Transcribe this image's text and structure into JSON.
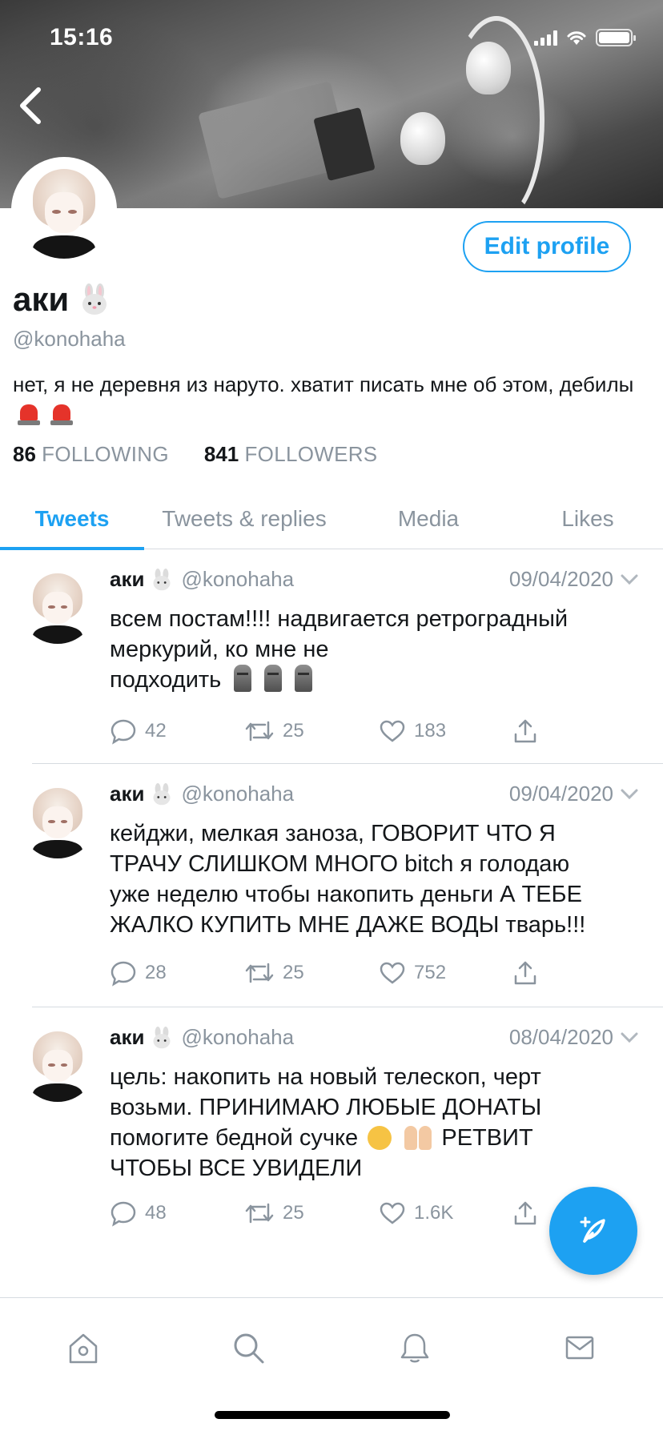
{
  "status_bar": {
    "time": "15:16"
  },
  "profile": {
    "name": "аки",
    "handle": "@konohaha",
    "bio": "нет, я не деревня из наруто. хватит писать мне об этом, дебилы",
    "following_count": "86",
    "following_label": "FOLLOWING",
    "followers_count": "841",
    "followers_label": "FOLLOWERS",
    "edit_label": "Edit profile"
  },
  "tabs": [
    {
      "label": "Tweets",
      "active": true
    },
    {
      "label": "Tweets & replies",
      "active": false
    },
    {
      "label": "Media",
      "active": false
    },
    {
      "label": "Likes",
      "active": false
    }
  ],
  "tweets": [
    {
      "name": "аки",
      "handle": "@konohaha",
      "date": "09/04/2020",
      "text_lines": [
        "всем постам!!!! надвигается ретроградный",
        "меркурий, ко мне не",
        "подходить"
      ],
      "replies": "42",
      "retweets": "25",
      "likes": "183"
    },
    {
      "name": "аки",
      "handle": "@konohaha",
      "date": "09/04/2020",
      "text_lines": [
        "кейджи, мелкая заноза, ГОВОРИТ ЧТО Я",
        "ТРАЧУ СЛИШКОМ МНОГО bitch я голодаю",
        "уже неделю чтобы накопить деньги А ТЕБЕ",
        "ЖАЛКО КУПИТЬ МНЕ ДАЖЕ ВОДЫ тварь!!!"
      ],
      "replies": "28",
      "retweets": "25",
      "likes": "752"
    },
    {
      "name": "аки",
      "handle": "@konohaha",
      "date": "08/04/2020",
      "text_lines": [
        "цель: накопить на новый телескоп, черт",
        "возьми. ПРИНИМАЮ ЛЮБЫЕ ДОНАТЫ",
        "помогите бедной сучке",
        "ЧТОБЫ ВСЕ УВИДЕЛИ"
      ],
      "text_suffix": "РЕТВИТ",
      "replies": "48",
      "retweets": "25",
      "likes": "1.6K"
    }
  ],
  "icons": {
    "back": "chevron-left-icon",
    "reply": "comment-icon",
    "retweet": "retweet-icon",
    "like": "heart-icon",
    "share": "share-icon",
    "compose": "feather-plus-icon",
    "home": "home-icon",
    "search": "search-icon",
    "notifications": "bell-icon",
    "messages": "mail-icon"
  },
  "colors": {
    "accent": "#1da1f2",
    "muted": "#8a949e",
    "text": "#14171a"
  }
}
